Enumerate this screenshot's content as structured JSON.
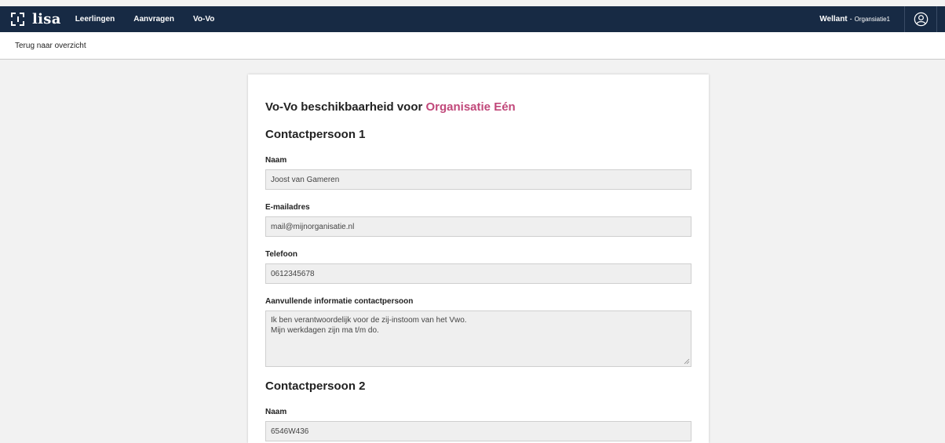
{
  "topbar": {
    "logo_text": "lisa",
    "nav": [
      {
        "label": "Leerlingen"
      },
      {
        "label": "Aanvragen"
      },
      {
        "label": "Vo-Vo"
      }
    ],
    "school": "Wellant",
    "separator": "-",
    "organisation": "Organsiatie1"
  },
  "subbar": {
    "back_label": "Terug naar overzicht"
  },
  "page": {
    "title_prefix": "Vo-Vo beschikbaarheid voor",
    "title_org": "Organisatie Eén"
  },
  "contact1": {
    "heading": "Contactpersoon 1",
    "name_label": "Naam",
    "name_value": "Joost van Gameren",
    "email_label": "E-mailadres",
    "email_value": "mail@mijnorganisatie.nl",
    "phone_label": "Telefoon",
    "phone_value": "0612345678",
    "info_label": "Aanvullende informatie contactpersoon",
    "info_value": "Ik ben verantwoordelijk voor de zij-instoom van het Vwo.\nMijn werkdagen zijn ma t/m do."
  },
  "contact2": {
    "heading": "Contactpersoon 2",
    "name_label": "Naam",
    "name_value": "6546W436"
  },
  "colors": {
    "topbar_bg": "#172a44",
    "accent": "#c1487a",
    "page_bg": "#f2f2f2"
  }
}
